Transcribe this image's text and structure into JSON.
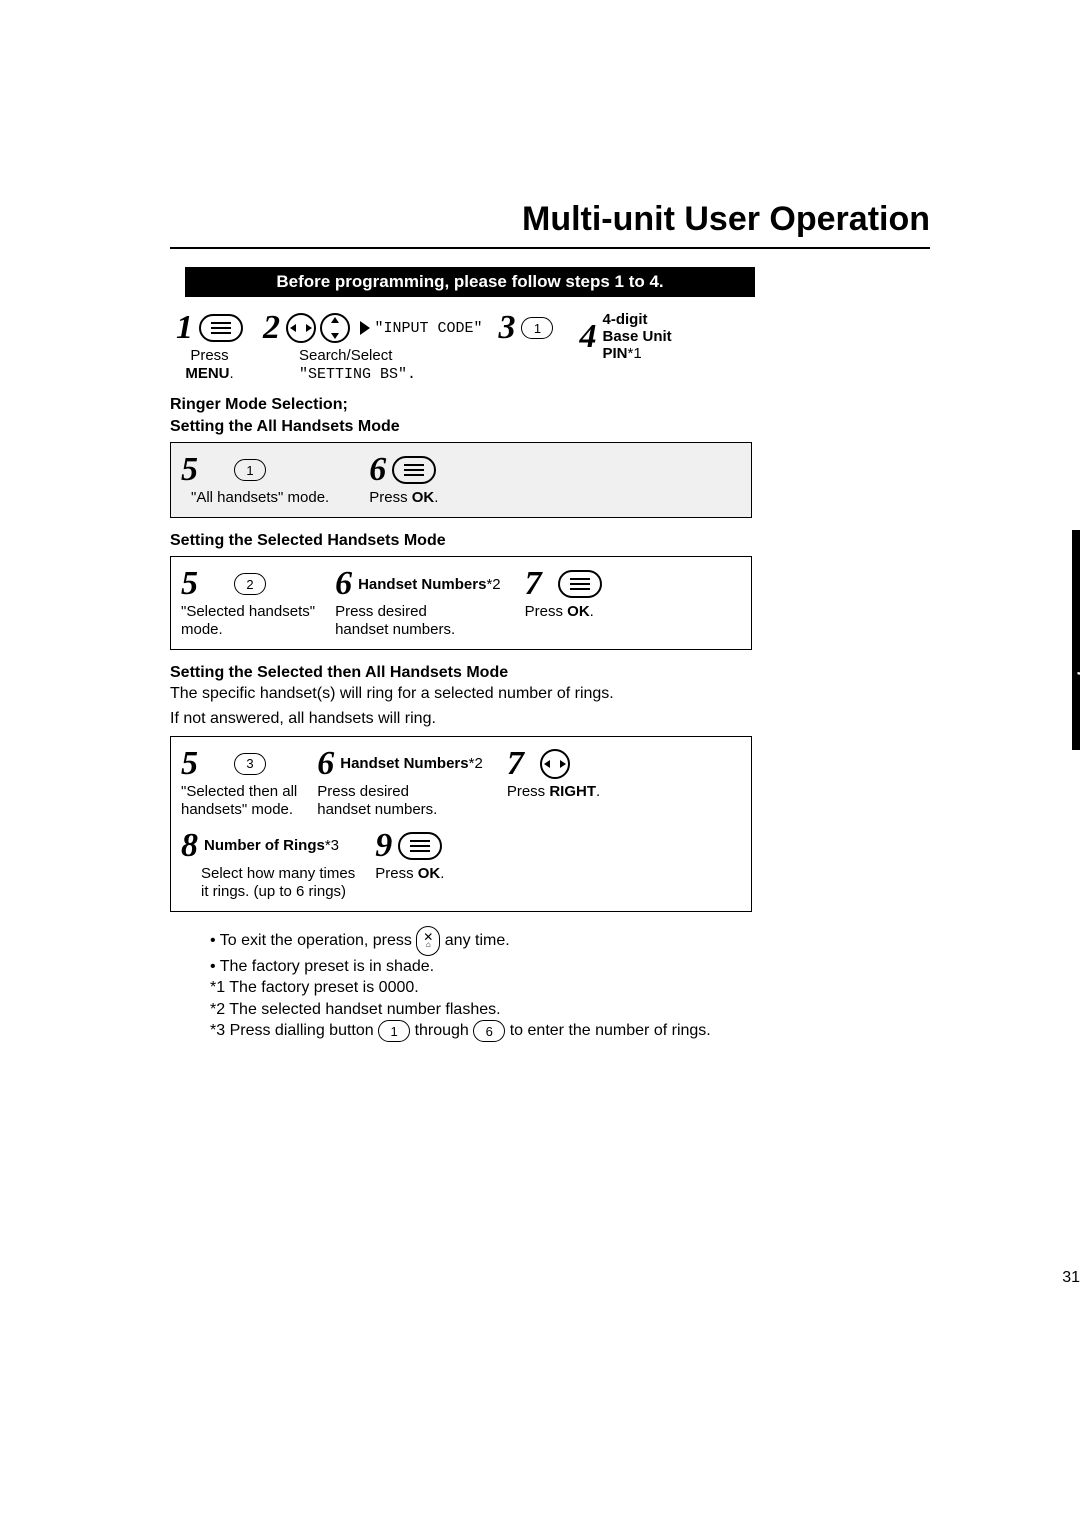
{
  "title": "Multi-unit User Operation",
  "tab_label": "Cordless Telephone",
  "blackbar": "Before programming, please follow steps 1 to 4.",
  "intro": {
    "s1_num": "1",
    "s1_sub_press": "Press",
    "s1_sub_menu": "MENU",
    "s2_num": "2",
    "s2_sub_a": "Search/Select",
    "s2_sub_b": "\"SETTING BS\".",
    "arrow_code": "\"INPUT CODE\"",
    "s3_num": "3",
    "s4_num": "4",
    "s4_a": "4-digit",
    "s4_b": "Base Unit",
    "s4_c": "PIN",
    "s4_d": "*1"
  },
  "sectionA_head1": "Ringer Mode Selection;",
  "sectionA_head2": "Setting the All Handsets Mode",
  "sectionA": {
    "s5_num": "5",
    "s5_dial": "1",
    "s5_sub": "\"All handsets\" mode.",
    "s6_num": "6",
    "s6_sub": "Press ",
    "s6_sub_b": "OK",
    "s6_sub_c": "."
  },
  "sectionB_head": "Setting the Selected Handsets Mode",
  "sectionB": {
    "s5_num": "5",
    "s5_dial": "2",
    "s5_sub_a": "\"Selected handsets\"",
    "s5_sub_b": "mode.",
    "s6_num": "6",
    "s6_title": "Handset Numbers",
    "s6_star": "*2",
    "s6_sub_a": "Press desired",
    "s6_sub_b": "handset numbers.",
    "s7_num": "7",
    "s7_sub": "Press ",
    "s7_sub_b": "OK",
    "s7_sub_c": "."
  },
  "sectionC_head": "Setting the Selected then All Handsets Mode",
  "sectionC_desc1": "The specific handset(s) will ring for a selected number of rings.",
  "sectionC_desc2": "If not answered, all handsets will ring.",
  "sectionC": {
    "s5_num": "5",
    "s5_dial": "3",
    "s5_sub_a": "\"Selected then all",
    "s5_sub_b": "handsets\" mode.",
    "s6_num": "6",
    "s6_title": "Handset Numbers",
    "s6_star": "*2",
    "s6_sub_a": "Press desired",
    "s6_sub_b": "handset numbers.",
    "s7_num": "7",
    "s7_sub": "Press ",
    "s7_sub_b": "RIGHT",
    "s7_sub_c": ".",
    "s8_num": "8",
    "s8_title": "Number of Rings",
    "s8_star": "*3",
    "s8_sub_a": "Select how many times",
    "s8_sub_b": "it rings. (up to 6 rings)",
    "s9_num": "9",
    "s9_sub": "Press ",
    "s9_sub_b": "OK",
    "s9_sub_c": "."
  },
  "foot": {
    "b1a": "To exit the operation, press ",
    "b1b": " any time.",
    "b2": "The factory preset is in shade.",
    "f1": "*1 The factory preset is 0000.",
    "f2": "*2 The selected handset number flashes.",
    "f3a": "*3 Press dialling button ",
    "f3b": " through ",
    "f3c": " to enter the number of rings.",
    "dial_low": "1",
    "dial_high": "6"
  },
  "page_number": "31"
}
